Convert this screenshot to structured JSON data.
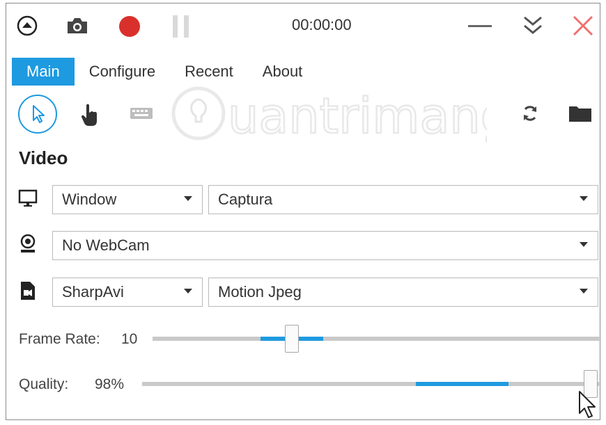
{
  "window": {
    "timer": "00:00:00"
  },
  "menu": {
    "items": [
      {
        "label": "Main",
        "active": true
      },
      {
        "label": "Configure",
        "active": false
      },
      {
        "label": "Recent",
        "active": false
      },
      {
        "label": "About",
        "active": false
      }
    ]
  },
  "toolbar": {
    "icons": [
      "cursor-icon",
      "hand-icon",
      "keyboard-icon",
      "refresh-icon",
      "folder-icon"
    ]
  },
  "watermark": {
    "text": "Quantrimang"
  },
  "video": {
    "title": "Video",
    "screen_source": "Window",
    "window_target": "Captura",
    "webcam": "No WebCam",
    "writer": "SharpAvi",
    "codec": "Motion Jpeg"
  },
  "frame_rate": {
    "label": "Frame Rate:",
    "value": "10"
  },
  "quality": {
    "label": "Quality:",
    "value": "98%"
  },
  "colors": {
    "accent": "#1e9ae0",
    "record": "#d9302c",
    "close": "#f07070"
  }
}
